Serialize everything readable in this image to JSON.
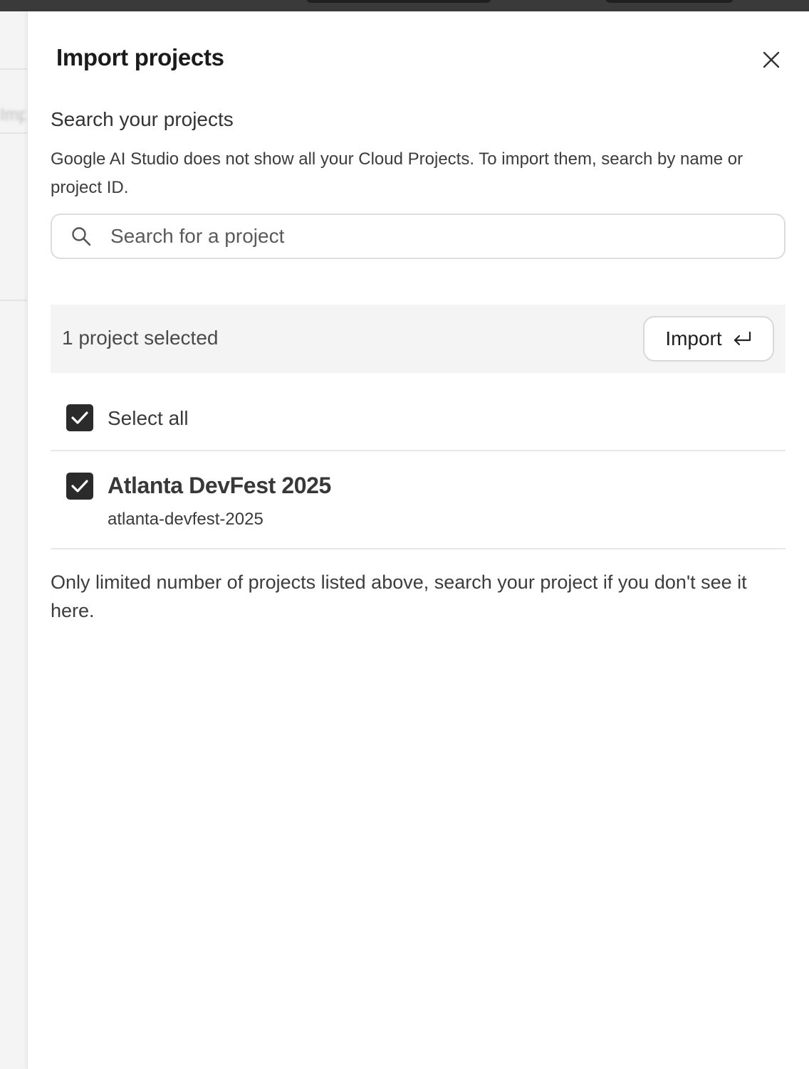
{
  "dialog": {
    "title": "Import projects",
    "close_icon": "close-icon"
  },
  "search": {
    "heading": "Search your projects",
    "description": "Google AI Studio does not show all your Cloud Projects. To import them, search by name or project ID.",
    "placeholder": "Search for a project",
    "value": "",
    "icon": "search-icon"
  },
  "selection": {
    "count_label": "1 project selected",
    "import_label": "Import",
    "import_icon": "return-arrow-icon"
  },
  "select_all": {
    "label": "Select all",
    "checked": true
  },
  "projects": [
    {
      "name": "Atlanta DevFest 2025",
      "id": "atlanta-devfest-2025",
      "checked": true
    }
  ],
  "footnote": "Only limited number of projects listed above, search your project if you don't see it here.",
  "colors": {
    "checkbox": "#2b2b2b",
    "selection_bar": "#f4f4f4"
  }
}
